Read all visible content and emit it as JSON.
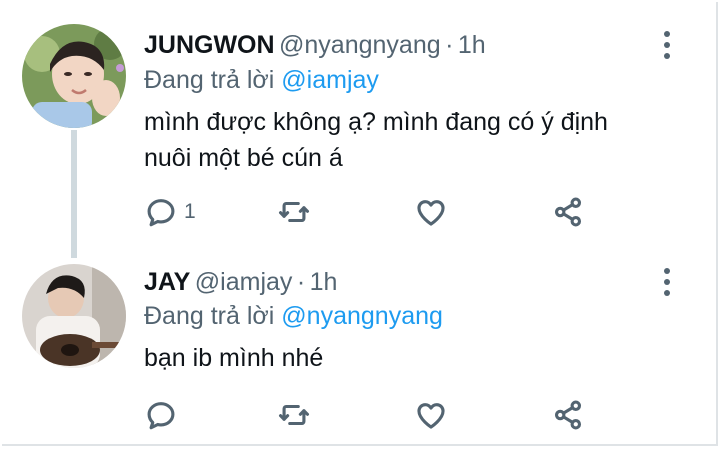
{
  "tweets": [
    {
      "name": "JUNGWON",
      "handle": "@nyangnyang",
      "separator": "·",
      "time": "1h",
      "reply_prefix": "Đang trả lời",
      "reply_to": "@iamjay",
      "text_line1": "mình được không ạ? mình đang có ý định",
      "text_line2": "nuôi một bé cún á",
      "reply_count": "1"
    },
    {
      "name": "JAY",
      "handle": "@iamjay",
      "separator": "·",
      "time": "1h",
      "reply_prefix": "Đang trả lời",
      "reply_to": "@nyangnyang",
      "text_line1": "bạn ib mình nhé",
      "reply_count": ""
    }
  ],
  "colors": {
    "accent": "#1d9bf0",
    "muted": "#536471",
    "text": "#0f1419",
    "thread_line": "#cfd9de"
  },
  "icons": [
    "reply-icon",
    "retweet-icon",
    "like-icon",
    "share-icon",
    "more-icon"
  ]
}
